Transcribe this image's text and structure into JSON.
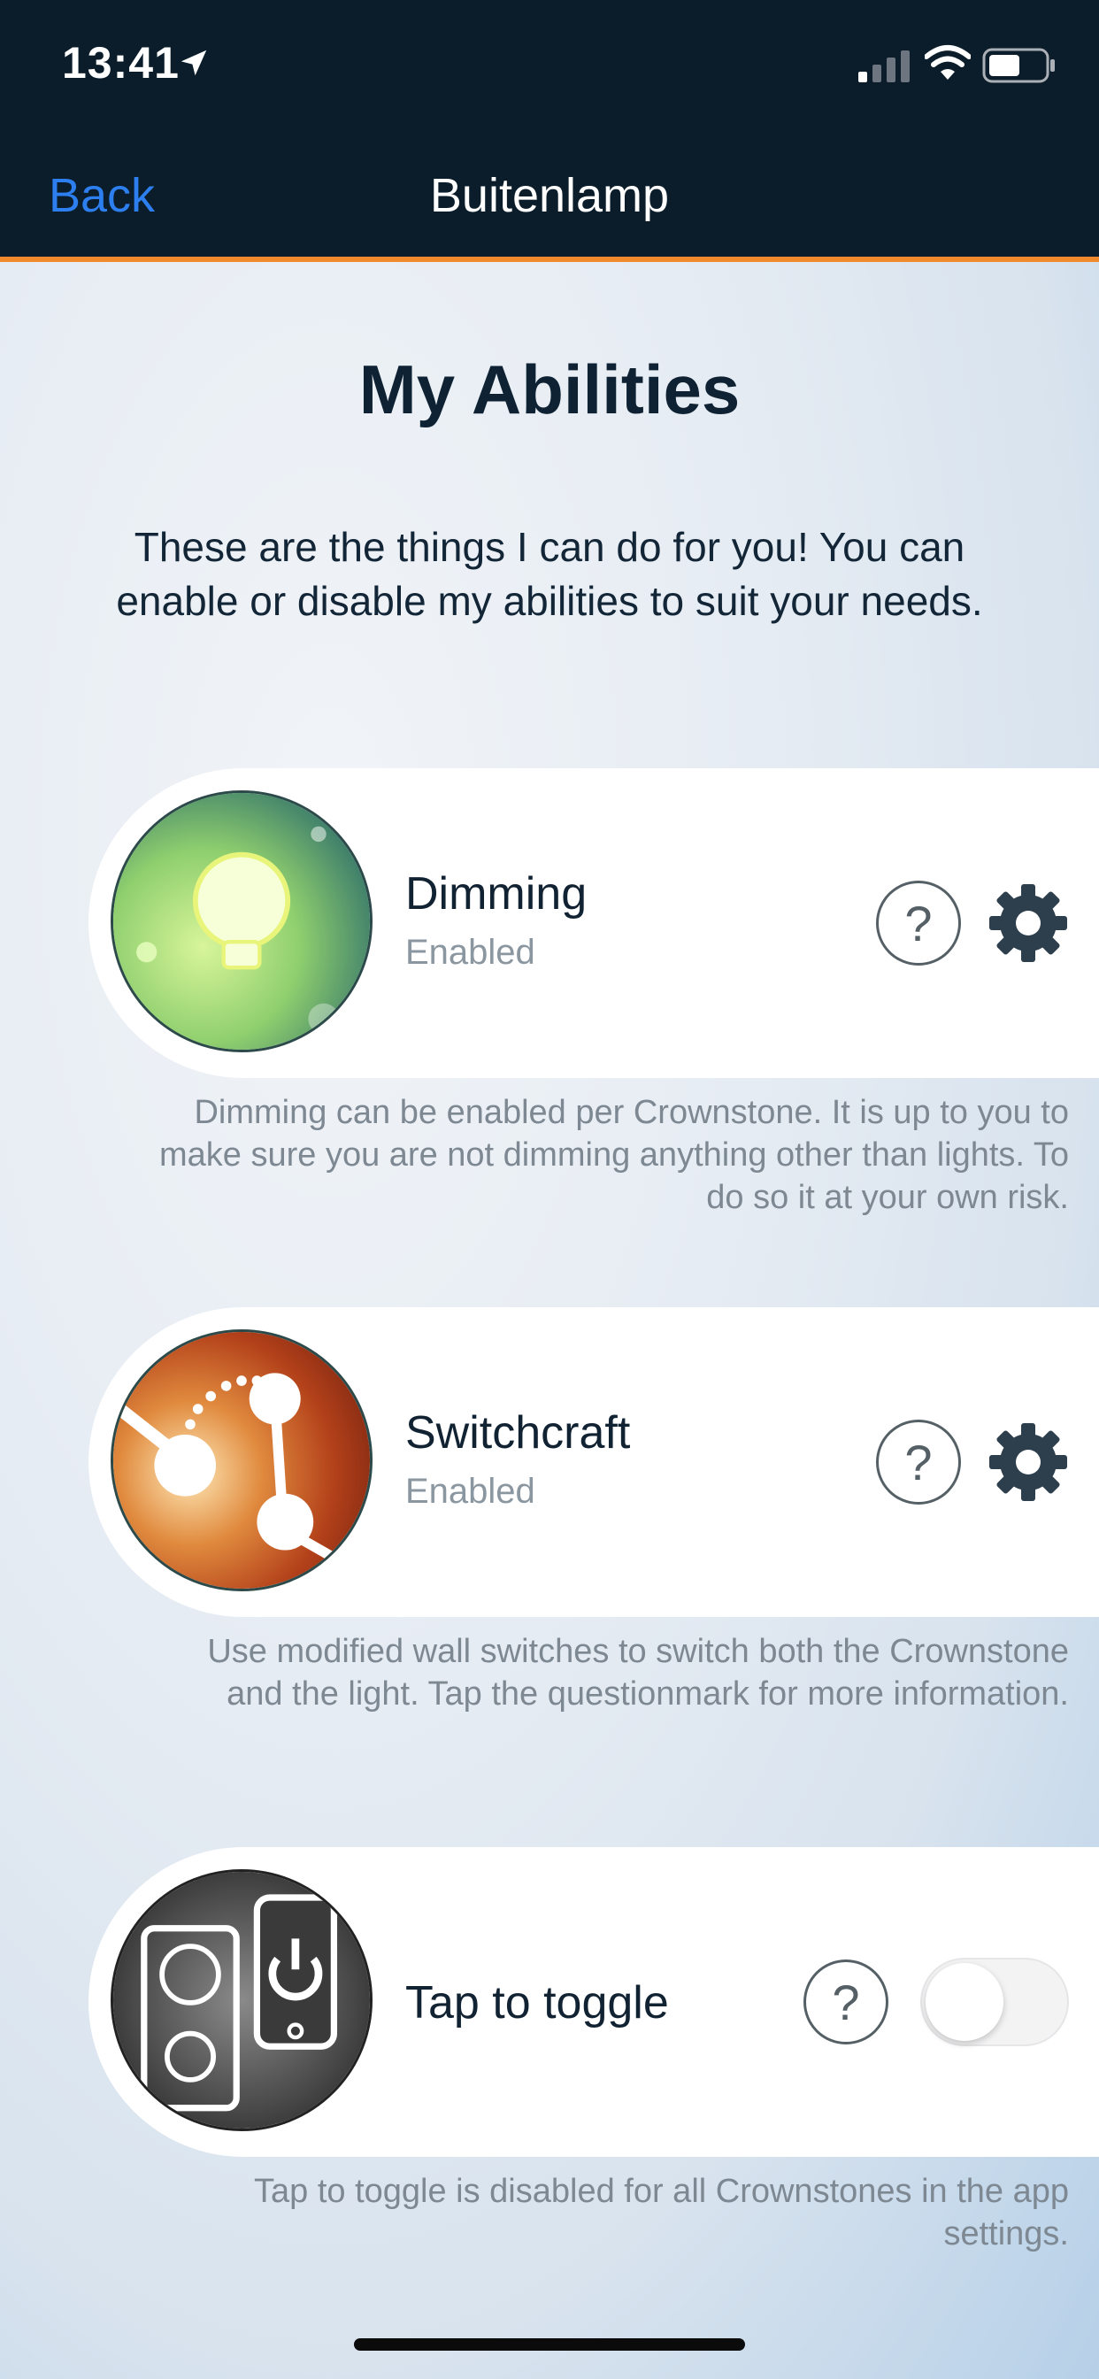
{
  "status_bar": {
    "time": "13:41",
    "icons": [
      "location-arrow-icon",
      "cellular-signal-icon",
      "wifi-icon",
      "battery-icon"
    ]
  },
  "nav": {
    "back_label": "Back",
    "title": "Buitenlamp",
    "accent_color": "#f08a2c"
  },
  "page": {
    "title": "My Abilities",
    "intro": "These are the things I can do for you! You can enable or disable my abilities to suit your needs."
  },
  "abilities": [
    {
      "name": "Dimming",
      "status": "Enabled",
      "icon": "lightbulb-icon",
      "controls": [
        "help-button",
        "settings-gear-button"
      ],
      "description": "Dimming can be enabled per Crownstone. It is up to you to make sure you are not dimming anything other than lights. To do so it at your own risk."
    },
    {
      "name": "Switchcraft",
      "status": "Enabled",
      "icon": "switchcraft-icon",
      "controls": [
        "help-button",
        "settings-gear-button"
      ],
      "description": "Use modified wall switches to switch both the Crownstone and the light. Tap the questionmark for more information."
    },
    {
      "name": "Tap to toggle",
      "status": "",
      "icon": "tap-to-toggle-icon",
      "toggle_on": false,
      "controls": [
        "help-button",
        "toggle-switch"
      ],
      "description": "Tap to toggle is disabled for all Crownstones in the app settings."
    }
  ],
  "help_glyph": "?"
}
